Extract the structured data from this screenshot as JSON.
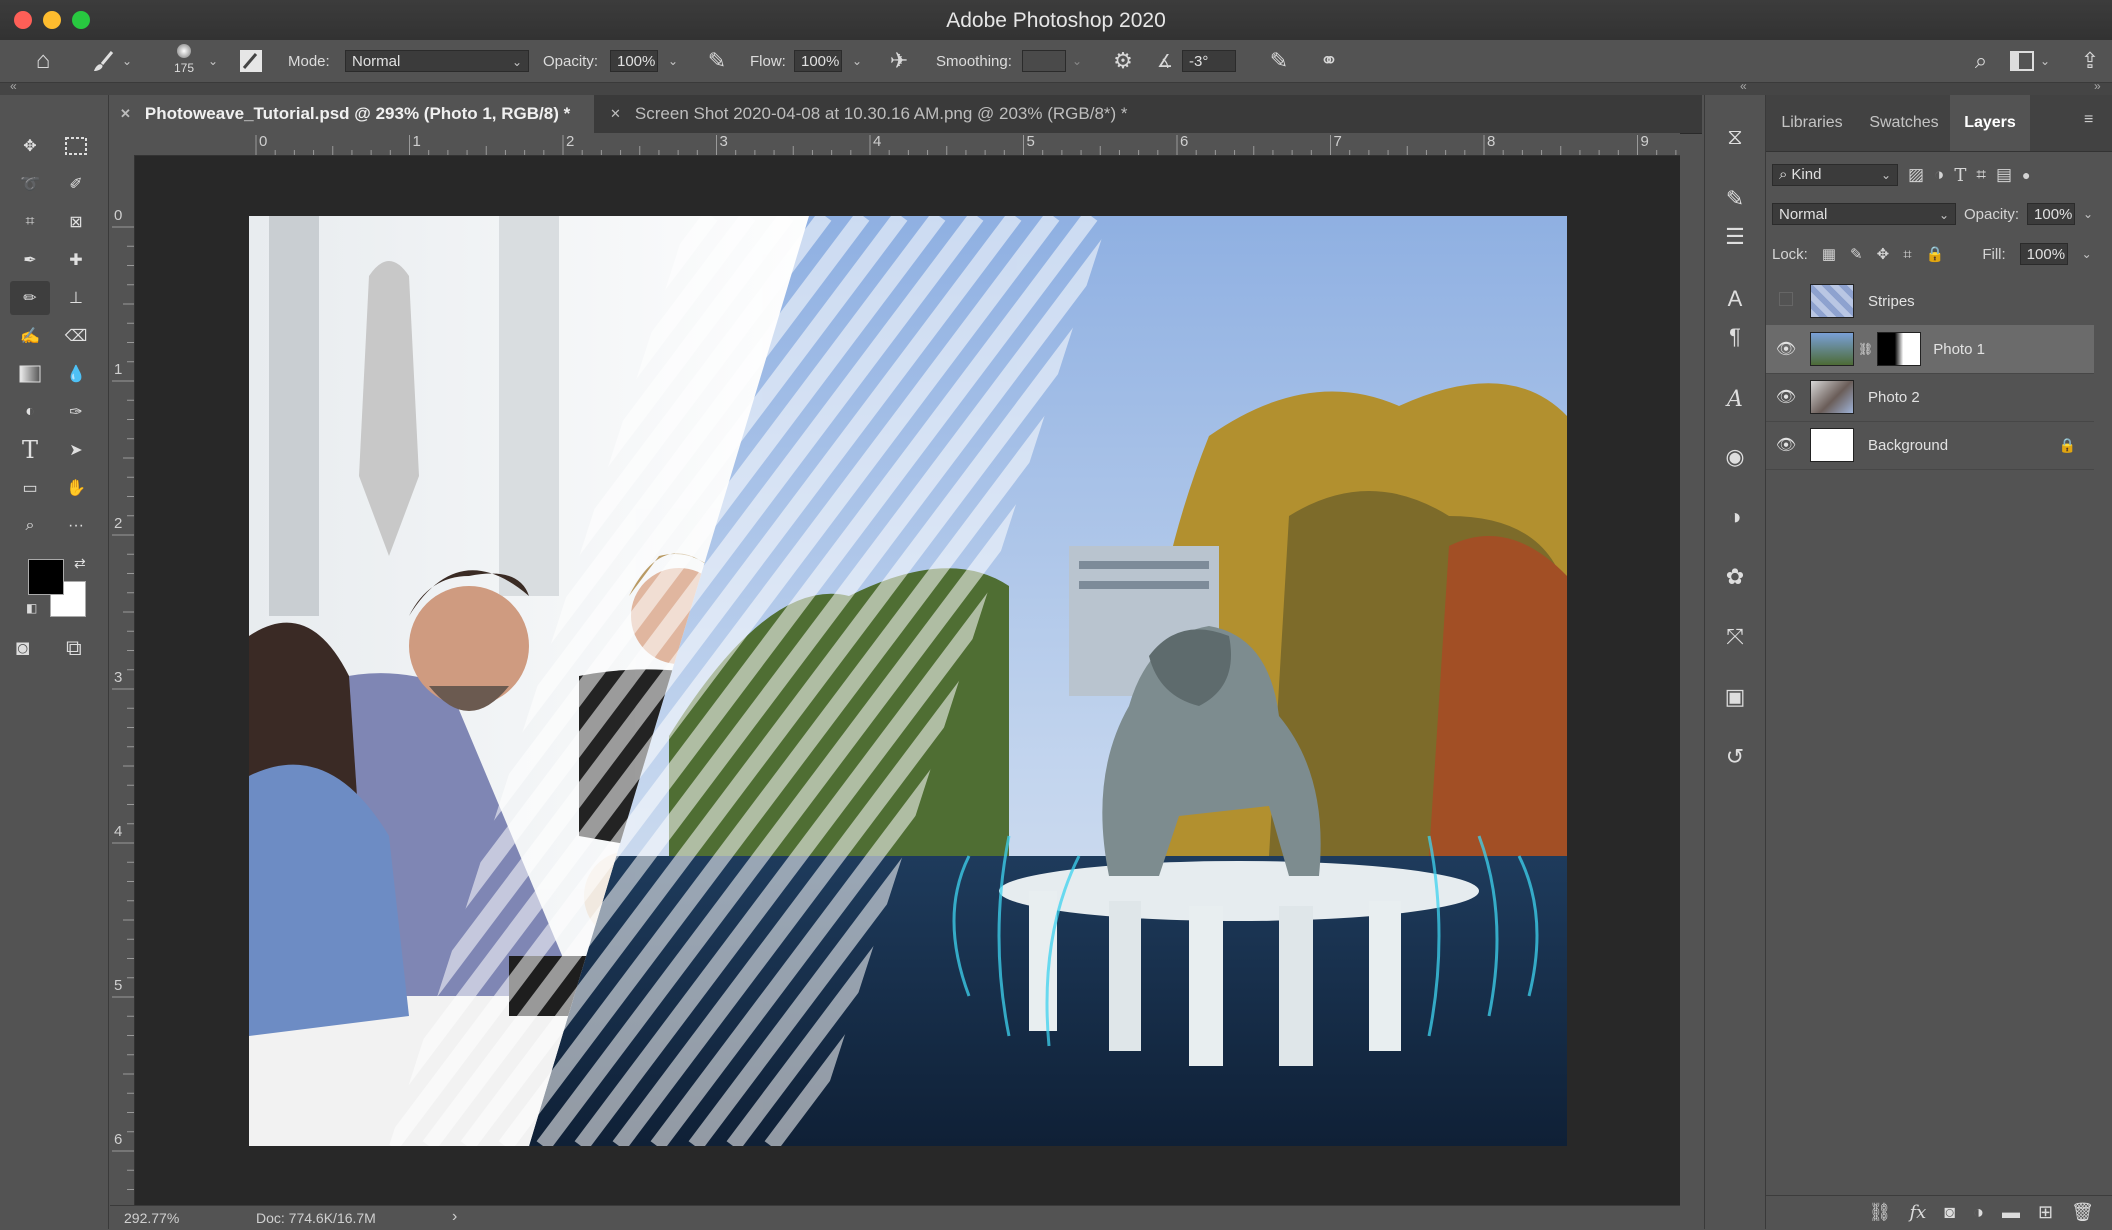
{
  "app": {
    "title": "Adobe Photoshop 2020"
  },
  "options": {
    "brush_size": "175",
    "mode_label": "Mode:",
    "mode_value": "Normal",
    "opacity_label": "Opacity:",
    "opacity_value": "100%",
    "flow_label": "Flow:",
    "flow_value": "100%",
    "smoothing_label": "Smoothing:",
    "smoothing_value": "",
    "angle_value": "-3°"
  },
  "tabs": [
    {
      "label": "Photoweave_Tutorial.psd @ 293% (Photo 1, RGB/8) *",
      "active": true
    },
    {
      "label": "Screen Shot 2020-04-08 at 10.30.16 AM.png @ 203% (RGB/8*) *",
      "active": false
    }
  ],
  "ruler": {
    "h": [
      "0",
      "1",
      "2",
      "3",
      "4",
      "5",
      "6",
      "7",
      "8",
      "9"
    ],
    "v": [
      "0",
      "1",
      "2",
      "3",
      "4",
      "5",
      "6"
    ]
  },
  "status": {
    "zoom": "292.77%",
    "doc": "Doc: 774.6K/16.7M",
    "arrow": "›"
  },
  "panel": {
    "tabs": [
      "Libraries",
      "Swatches",
      "Layers"
    ],
    "active_tab": "Layers",
    "filter_kind": "Kind",
    "blend_mode": "Normal",
    "opacity_label": "Opacity:",
    "opacity_value": "100%",
    "lock_label": "Lock:",
    "fill_label": "Fill:",
    "fill_value": "100%",
    "layers": [
      {
        "name": "Stripes",
        "visible": false,
        "selected": false
      },
      {
        "name": "Photo 1",
        "visible": true,
        "selected": true
      },
      {
        "name": "Photo 2",
        "visible": true,
        "selected": false
      },
      {
        "name": "Background",
        "visible": true,
        "selected": false,
        "locked": true
      }
    ]
  },
  "colors": {
    "foreground": "#000000",
    "background": "#ffffff",
    "accent_traffic_red": "#fe5f57",
    "accent_traffic_yellow": "#febc2e",
    "accent_traffic_green": "#28c840"
  }
}
